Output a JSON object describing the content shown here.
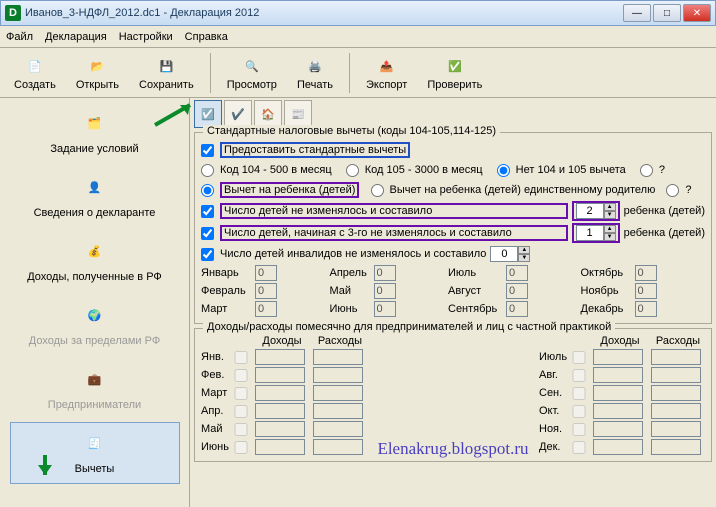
{
  "window": {
    "title": "Иванов_3-НДФЛ_2012.dc1 - Декларация 2012"
  },
  "menu": {
    "file": "Файл",
    "decl": "Декларация",
    "settings": "Настройки",
    "help": "Справка"
  },
  "toolbar": {
    "create": "Создать",
    "open": "Открыть",
    "save": "Сохранить",
    "view": "Просмотр",
    "print": "Печать",
    "export": "Экспорт",
    "check": "Проверить"
  },
  "sidebar": {
    "conditions": "Задание условий",
    "declarant": "Сведения о декларанте",
    "income_rf": "Доходы, полученные в РФ",
    "income_abroad": "Доходы за пределами РФ",
    "entrepreneurs": "Предприниматели",
    "deductions": "Вычеты"
  },
  "group1": {
    "title": "Стандартные налоговые вычеты (коды 104-105,114-125)",
    "cb_provide": "Предоставить стандартные вычеты",
    "r104": "Код 104 - 500 в месяц",
    "r105": "Код 105 - 3000 в месяц",
    "r_none": "Нет 104 и 105 вычета",
    "r_q1": "?",
    "r_child": "Вычет на ребенка (детей)",
    "r_child_single": "Вычет на ребенка (детей) единственному родителю",
    "r_q2": "?",
    "cb_children": "Число детей не изменялось и составило",
    "cb_children_val": "2",
    "suffix_child": "ребенка (детей)",
    "cb_children3": "Число детей, начиная с 3-го не изменялось и составило",
    "cb_children3_val": "1",
    "cb_invalid": "Число детей инвалидов не изменялось и составило",
    "cb_invalid_val": "0"
  },
  "months": {
    "jan": "Январь",
    "feb": "Февраль",
    "mar": "Март",
    "apr": "Апрель",
    "may": "Май",
    "jun": "Июнь",
    "jul": "Июль",
    "aug": "Август",
    "sep": "Сентябрь",
    "oct": "Октябрь",
    "nov": "Ноябрь",
    "dec": "Декабрь",
    "zero": "0"
  },
  "group2": {
    "title": "Доходы/расходы помесячно для предпринимателей и лиц с частной практикой",
    "income": "Доходы",
    "expense": "Расходы",
    "m1": "Янв.",
    "m2": "Фев.",
    "m3": "Март",
    "m4": "Апр.",
    "m5": "Май",
    "m6": "Июнь",
    "m7": "Июль",
    "m8": "Авг.",
    "m9": "Сен.",
    "m10": "Окт.",
    "m11": "Ноя.",
    "m12": "Дек."
  },
  "watermark": "Elenakrug.blogspot.ru"
}
